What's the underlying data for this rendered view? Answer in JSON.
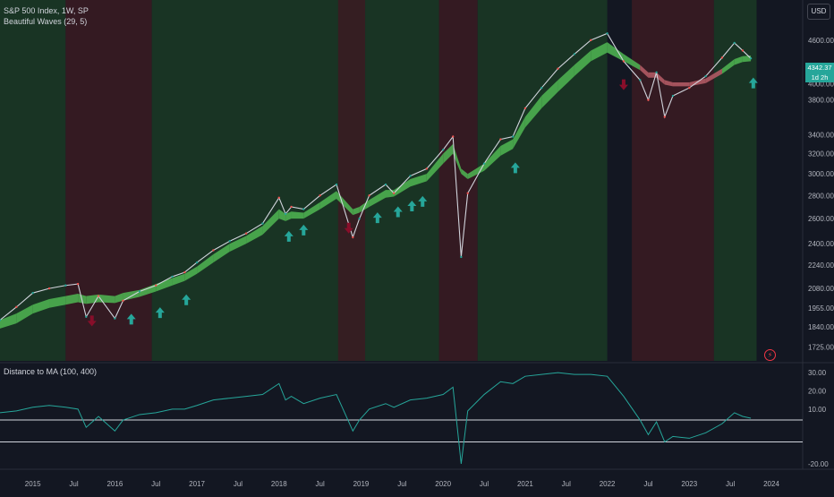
{
  "header": {
    "symbol_line": "S&P 500 Index, 1W, SP",
    "indicator_line": "Beautiful Waves (29, 5)",
    "currency": "USD"
  },
  "price_tag": {
    "value": "4342.37",
    "countdown": "1d 2h",
    "color": "#26a69a"
  },
  "lower_pane": {
    "title": "Distance to MA (100, 400)"
  },
  "colors": {
    "background": "#131722",
    "band_green": "#4caf50",
    "band_red": "#b05a64",
    "line": "#26a69a",
    "arrow_up": "#26a69a",
    "arrow_down": "#880e2a",
    "regime_green": "#1b3a24",
    "regime_red": "#3b1b22"
  },
  "icons": {
    "flash": "lightning-icon"
  },
  "chart_data": [
    {
      "type": "line",
      "name_note": "price",
      "title": "S&P 500 Index, 1W, SP",
      "y_scale": "log",
      "ylim": [
        1650,
        4800
      ],
      "y_ticks": [
        4600,
        4000,
        3800,
        3400,
        3200,
        3000,
        2800,
        2600,
        2400,
        2240,
        2080,
        1955,
        1840,
        1725
      ],
      "y_tick_labels": [
        "4600.00",
        "4000.00",
        "3800.00",
        "3400.00",
        "3200.00",
        "3000.00",
        "2800.00",
        "2600.00",
        "2400.00",
        "2240.00",
        "2080.00",
        "1955.00",
        "1840.00",
        "1725.00"
      ],
      "x_range": [
        2014.6,
        2024.0
      ],
      "x_ticks": [
        2015,
        2015.5,
        2016,
        2016.5,
        2017,
        2017.5,
        2018,
        2018.5,
        2019,
        2019.5,
        2020,
        2020.5,
        2021,
        2021.5,
        2022,
        2022.5,
        2023,
        2023.5,
        2024
      ],
      "x_tick_labels": [
        "2015",
        "Jul",
        "2016",
        "Jul",
        "2017",
        "Jul",
        "2018",
        "Jul",
        "2019",
        "Jul",
        "2020",
        "Jul",
        "2021",
        "Jul",
        "2022",
        "Jul",
        "2023",
        "Jul",
        "2024"
      ],
      "x": [
        2014.6,
        2014.8,
        2015.0,
        2015.2,
        2015.4,
        2015.55,
        2015.65,
        2015.8,
        2016.0,
        2016.1,
        2016.3,
        2016.5,
        2016.7,
        2016.85,
        2017.0,
        2017.2,
        2017.4,
        2017.6,
        2017.8,
        2018.0,
        2018.08,
        2018.15,
        2018.3,
        2018.5,
        2018.7,
        2018.9,
        2018.98,
        2019.1,
        2019.3,
        2019.4,
        2019.6,
        2019.8,
        2020.0,
        2020.12,
        2020.22,
        2020.3,
        2020.5,
        2020.7,
        2020.85,
        2021.0,
        2021.2,
        2021.4,
        2021.6,
        2021.8,
        2022.0,
        2022.2,
        2022.4,
        2022.5,
        2022.6,
        2022.7,
        2022.8,
        2023.0,
        2023.2,
        2023.4,
        2023.55,
        2023.65,
        2023.75
      ],
      "y": [
        1880,
        1960,
        2050,
        2080,
        2100,
        2110,
        1900,
        2030,
        1890,
        2000,
        2060,
        2100,
        2160,
        2190,
        2260,
        2350,
        2420,
        2480,
        2560,
        2780,
        2640,
        2700,
        2680,
        2800,
        2900,
        2450,
        2600,
        2800,
        2900,
        2820,
        2980,
        3050,
        3240,
        3380,
        2300,
        2820,
        3100,
        3350,
        3380,
        3700,
        3950,
        4200,
        4400,
        4600,
        4700,
        4300,
        4050,
        3800,
        4150,
        3600,
        3850,
        3950,
        4100,
        4350,
        4560,
        4450,
        4340
      ],
      "ma_band_upper": [
        1880,
        1920,
        1975,
        2010,
        2030,
        2045,
        2030,
        2040,
        2030,
        2050,
        2070,
        2110,
        2150,
        2180,
        2230,
        2320,
        2400,
        2460,
        2540,
        2680,
        2640,
        2660,
        2650,
        2740,
        2840,
        2680,
        2700,
        2760,
        2850,
        2850,
        2950,
        3000,
        3200,
        3300,
        3050,
        3000,
        3100,
        3280,
        3350,
        3600,
        3850,
        4050,
        4250,
        4450,
        4570,
        4400,
        4250,
        4150,
        4150,
        4050,
        4020,
        4020,
        4070,
        4200,
        4330,
        4370,
        4380
      ],
      "ma_band_lower": [
        1830,
        1860,
        1920,
        1955,
        1975,
        1990,
        1980,
        1990,
        1985,
        2000,
        2025,
        2060,
        2100,
        2130,
        2180,
        2260,
        2340,
        2400,
        2470,
        2600,
        2580,
        2600,
        2600,
        2680,
        2770,
        2630,
        2650,
        2700,
        2780,
        2790,
        2880,
        2930,
        3100,
        3200,
        3000,
        2950,
        3030,
        3180,
        3250,
        3480,
        3700,
        3900,
        4100,
        4300,
        4420,
        4300,
        4180,
        4080,
        4080,
        3990,
        3970,
        3970,
        4010,
        4130,
        4250,
        4290,
        4300
      ],
      "ma_band_color": [
        "green",
        "green",
        "green",
        "green",
        "green",
        "green",
        "green",
        "green",
        "green",
        "green",
        "green",
        "green",
        "green",
        "green",
        "green",
        "green",
        "green",
        "green",
        "green",
        "green",
        "green",
        "green",
        "green",
        "green",
        "green",
        "green",
        "green",
        "green",
        "green",
        "green",
        "green",
        "green",
        "green",
        "green",
        "green",
        "green",
        "green",
        "green",
        "green",
        "green",
        "green",
        "green",
        "green",
        "green",
        "green",
        "green",
        "red",
        "red",
        "red",
        "red",
        "red",
        "red",
        "red",
        "green",
        "green",
        "green",
        "green"
      ],
      "regimes": [
        {
          "from": 2014.6,
          "to": 2015.4,
          "color": "green"
        },
        {
          "from": 2015.4,
          "to": 2016.45,
          "color": "red"
        },
        {
          "from": 2016.45,
          "to": 2019.95,
          "color": "green"
        },
        {
          "from": 2018.72,
          "to": 2019.05,
          "color": "red"
        },
        {
          "from": 2019.95,
          "to": 2020.42,
          "color": "red"
        },
        {
          "from": 2020.42,
          "to": 2022.0,
          "color": "green"
        },
        {
          "from": 2022.3,
          "to": 2023.3,
          "color": "red"
        },
        {
          "from": 2023.3,
          "to": 2023.82,
          "color": "green"
        }
      ],
      "signals": [
        {
          "x": 2015.72,
          "y": 1880,
          "dir": "down"
        },
        {
          "x": 2016.2,
          "y": 1880,
          "dir": "up"
        },
        {
          "x": 2016.55,
          "y": 1920,
          "dir": "up"
        },
        {
          "x": 2016.87,
          "y": 2000,
          "dir": "up"
        },
        {
          "x": 2018.12,
          "y": 2450,
          "dir": "up"
        },
        {
          "x": 2018.3,
          "y": 2500,
          "dir": "up"
        },
        {
          "x": 2018.85,
          "y": 2530,
          "dir": "down"
        },
        {
          "x": 2019.2,
          "y": 2600,
          "dir": "up"
        },
        {
          "x": 2019.45,
          "y": 2650,
          "dir": "up"
        },
        {
          "x": 2019.62,
          "y": 2700,
          "dir": "up"
        },
        {
          "x": 2019.75,
          "y": 2740,
          "dir": "up"
        },
        {
          "x": 2020.88,
          "y": 3050,
          "dir": "up"
        },
        {
          "x": 2022.2,
          "y": 4000,
          "dir": "down"
        },
        {
          "x": 2023.78,
          "y": 4000,
          "dir": "up"
        }
      ]
    },
    {
      "type": "line",
      "title": "Distance to MA (100, 400)",
      "ylim": [
        -22,
        33
      ],
      "y_ticks": [
        30,
        20,
        10,
        -20
      ],
      "y_tick_labels": [
        "30.00",
        "20.00",
        "10.00",
        "-20.00"
      ],
      "hlines": [
        4,
        -8
      ],
      "x": [
        2014.6,
        2014.8,
        2015.0,
        2015.2,
        2015.4,
        2015.55,
        2015.65,
        2015.8,
        2016.0,
        2016.1,
        2016.3,
        2016.5,
        2016.7,
        2016.85,
        2017.0,
        2017.2,
        2017.4,
        2017.6,
        2017.8,
        2018.0,
        2018.08,
        2018.15,
        2018.3,
        2018.5,
        2018.7,
        2018.9,
        2018.98,
        2019.1,
        2019.3,
        2019.4,
        2019.6,
        2019.8,
        2020.0,
        2020.12,
        2020.22,
        2020.3,
        2020.5,
        2020.7,
        2020.85,
        2021.0,
        2021.2,
        2021.4,
        2021.6,
        2021.8,
        2022.0,
        2022.2,
        2022.4,
        2022.5,
        2022.6,
        2022.7,
        2022.8,
        2023.0,
        2023.2,
        2023.4,
        2023.55,
        2023.65,
        2023.75
      ],
      "y": [
        8,
        9,
        11,
        12,
        11,
        10,
        0,
        6,
        -2,
        4,
        7,
        8,
        10,
        10,
        12,
        15,
        16,
        17,
        18,
        24,
        15,
        17,
        13,
        16,
        18,
        -2,
        4,
        10,
        13,
        11,
        15,
        16,
        18,
        22,
        -20,
        9,
        18,
        25,
        24,
        28,
        29,
        30,
        29,
        29,
        28,
        17,
        4,
        -4,
        3,
        -8,
        -5,
        -6,
        -3,
        2,
        8,
        6,
        5
      ]
    }
  ]
}
